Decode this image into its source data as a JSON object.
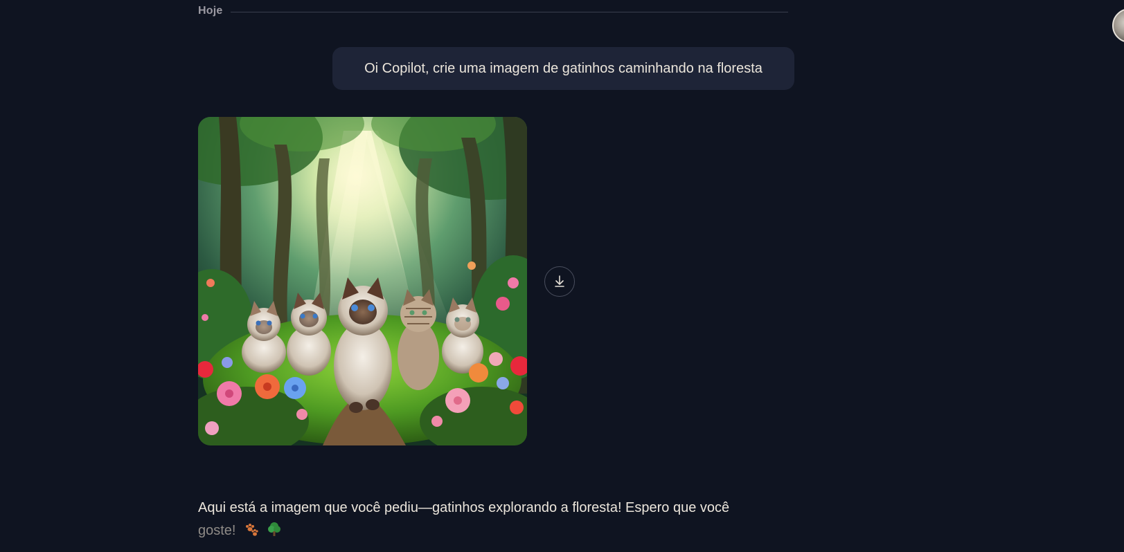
{
  "conversation": {
    "date_label": "Hoje",
    "user_message": "Oi Copilot, crie uma imagem de gatinhos caminhando na floresta",
    "assistant_message": {
      "line1": "Aqui está a imagem que você pediu—gatinhos explorando a floresta! Espero que você",
      "line2": "goste!"
    },
    "emojis": [
      "paw-prints-icon",
      "tree-icon"
    ]
  },
  "image": {
    "subject": "kittens walking in the forest",
    "kitten_count": 5
  },
  "actions": {
    "download_icon": "download-icon"
  },
  "colors": {
    "background": "#0f1421",
    "user_bubble": "#1e2437",
    "text": "#ece6dc",
    "muted": "#9c9aa3"
  }
}
